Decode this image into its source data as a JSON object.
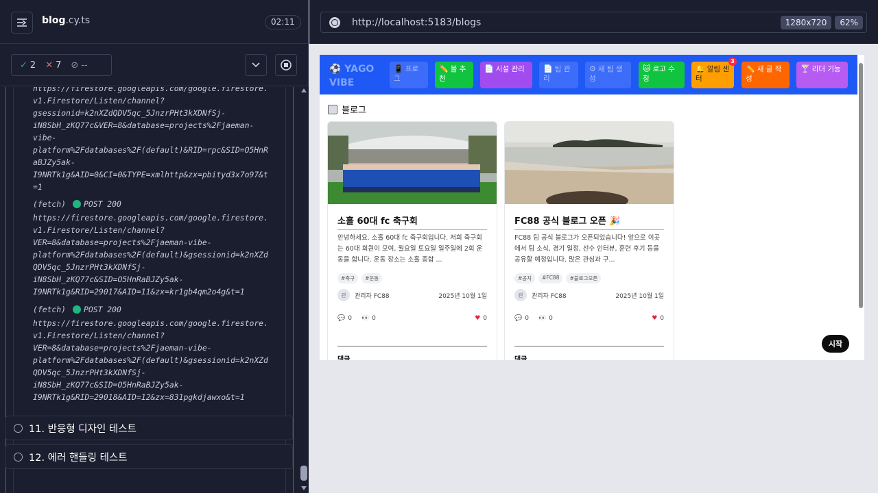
{
  "runner": {
    "spec_name": "blog",
    "spec_ext": ".cy.ts",
    "timer": "02:11",
    "passed": "2",
    "failed": "7",
    "pending": "--",
    "log_block_1": "https://firestore.googleapis.com/google.firestore.\nv1.Firestore/Listen/channel?\ngsessionid=k2nXZdQDV5qc_5JnzrPHt3kXDNfSj-\niN8SbH_zKQ77c&VER=8&database=projects%2Fjaeman-\nvibe-\nplatform%2Fdatabases%2F(default)&RID=rpc&SID=O5HnR\naBJZy5ak-\nI9NRTk1g&AID=0&CI=0&TYPE=xmlhttp&zx=pbityd3x7o97&t\n=1",
    "fetch_1": {
      "label": "(fetch)",
      "status": "POST 200"
    },
    "log_block_2": "https://firestore.googleapis.com/google.firestore.\nv1.Firestore/Listen/channel?\nVER=8&database=projects%2Fjaeman-vibe-\nplatform%2Fdatabases%2F(default)&gsessionid=k2nXZd\nQDV5qc_5JnzrPHt3kXDNfSj-\niN8SbH_zKQ77c&SID=O5HnRaBJZy5ak-\nI9NRTk1g&RID=29017&AID=11&zx=kr1gb4qm2o4g&t=1",
    "fetch_2": {
      "label": "(fetch)",
      "status": "POST 200"
    },
    "log_block_3": "https://firestore.googleapis.com/google.firestore.\nv1.Firestore/Listen/channel?\nVER=8&database=projects%2Fjaeman-vibe-\nplatform%2Fdatabases%2F(default)&gsessionid=k2nXZd\nQDV5qc_5JnzrPHt3kXDNfSj-\niN8SbH_zKQ77c&SID=O5HnRaBJZy5ak-\nI9NRTk1g&RID=29018&AID=12&zx=831pgkdjawxo&t=1",
    "tests": [
      {
        "label": "11. 반응형 디자인 테스트"
      },
      {
        "label": "12. 에러 핸들링 테스트"
      }
    ]
  },
  "url_bar": {
    "url": "http://localhost:5183/blogs",
    "viewport": "1280x720",
    "zoom": "62%"
  },
  "app": {
    "logo_line1": "⚽ YAGO",
    "logo_line2": "VIBE",
    "nav": [
      {
        "icon": "📱",
        "label": "프로그"
      },
      {
        "icon": "✏️",
        "label": "블 추천"
      },
      {
        "icon": "📄",
        "label": "시설 관리"
      },
      {
        "icon": "📄",
        "label": "팀 관리"
      },
      {
        "icon": "⚙",
        "label": "새 팀 생성"
      },
      {
        "icon": "🐱",
        "label": "로고 수정"
      },
      {
        "icon": "🔔",
        "label": "알림 센터"
      },
      {
        "icon": "✏️",
        "label": "새 글 작성"
      },
      {
        "icon": "🍸",
        "label": "리더 기능"
      }
    ],
    "notification_count": "3",
    "heading": "블로그",
    "posts": [
      {
        "title": "소흘 60대 fc 축구회",
        "excerpt": "안녕하세요. 소흘 60대 fc 축구회입니다. 저희 축구회는 60대 회원이 모여, 월요일 토요일 일주일에 2회 운동을 합니다. 운동 장소는 소흘 종합 ...",
        "tags": [
          "#축구",
          "#운동"
        ],
        "avatar": "관",
        "author": "관리자 FC88",
        "date": "2025년 10월 1일",
        "comments": "0",
        "views": "0",
        "likes": "0",
        "comments_label": "댓글"
      },
      {
        "title": "FC88 공식 블로그 오픈 🎉",
        "excerpt": "FC88 팀 공식 블로그가 오픈되었습니다! 앞으로 이곳에서 팀 소식, 경기 일정, 선수 인터뷰, 훈련 후기 등을 공유할 예정입니다. 많은 관심과 구...",
        "tags": [
          "#공지",
          "#FC88",
          "#블로그오픈"
        ],
        "avatar": "관",
        "author": "관리자 FC88",
        "date": "2025년 10월 1일",
        "comments": "0",
        "views": "0",
        "likes": "0",
        "comments_label": "댓글"
      }
    ],
    "start_button": "시작"
  }
}
